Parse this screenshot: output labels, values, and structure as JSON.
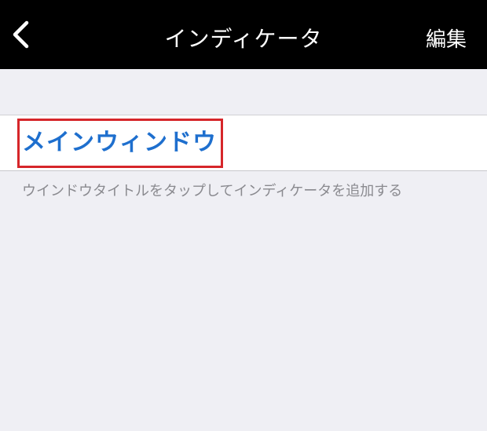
{
  "navbar": {
    "back_icon": "chevron-left-icon",
    "title": "インディケータ",
    "edit_label": "編集",
    "background": "#000000",
    "text_color": "#ffffff"
  },
  "list": {
    "item_label": "メインウィンドウ",
    "item_color": "#1e6fce",
    "highlight_color": "#d6262a",
    "footer": "ウインドウタイトルをタップしてインディケータを追加する"
  },
  "colors": {
    "page_background": "#efeff4",
    "footer_text": "#8a8a8f"
  }
}
